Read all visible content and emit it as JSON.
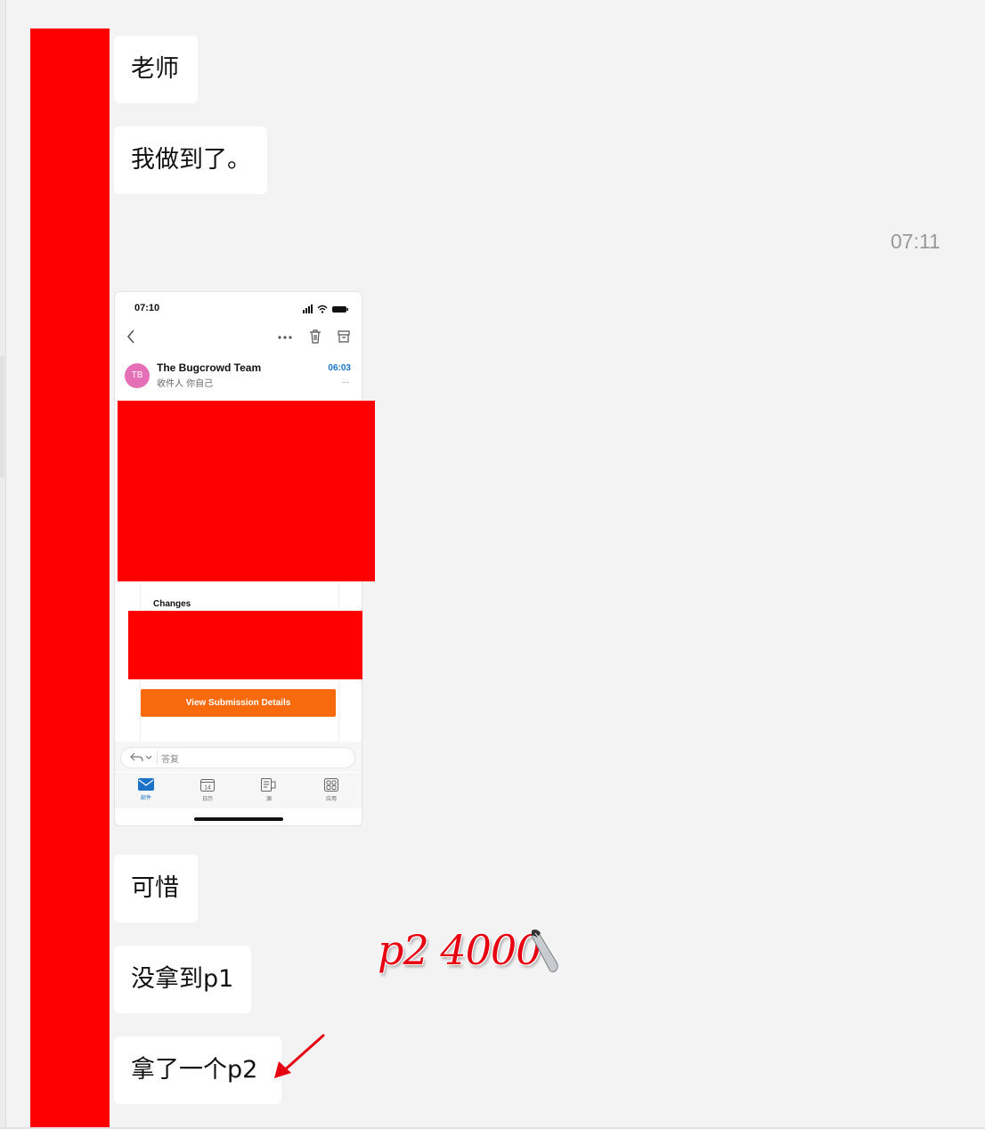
{
  "chat": {
    "messages": [
      {
        "text": "老师"
      },
      {
        "text": "我做到了。"
      },
      {
        "text": "可惜"
      },
      {
        "text": "没拿到p1"
      },
      {
        "text": "拿了一个p2"
      }
    ],
    "timestamp": "07:11"
  },
  "screenshot": {
    "status_time": "07:10",
    "sender_initials": "TB",
    "sender_name": "The Bugcrowd Team",
    "recipient": "收件人 你自己",
    "mail_time": "06:03",
    "mail_more": "...",
    "changes_label": "Changes",
    "cta_label": "View Submission Details",
    "reply_placeholder": "答复",
    "tabs": [
      {
        "label": "邮件",
        "icon": "mail-icon"
      },
      {
        "label": "日历",
        "icon": "calendar-icon",
        "day": "14"
      },
      {
        "label": "源",
        "icon": "feed-icon"
      },
      {
        "label": "应用",
        "icon": "apps-icon"
      }
    ],
    "accent_color": "#f76b0e",
    "link_color": "#1a73c8"
  },
  "annotation": {
    "text": "p2 4000",
    "color": "#e60012"
  },
  "redaction_color": "#ff0000"
}
